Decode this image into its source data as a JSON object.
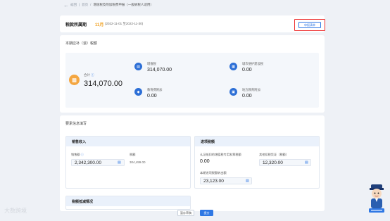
{
  "breadcrumb": {
    "back": "返回",
    "home": "首页",
    "current": "增值税及附加税费申报（一般纳税人适用）"
  },
  "period": {
    "label": "税款所属期",
    "month": "11月",
    "range": "(2022-11-01 至2022-11-30)",
    "action_button": "申报清单"
  },
  "tax_summary": {
    "title": "本期应补（退）税额",
    "total_label": "合计",
    "total_value": "314,070.00",
    "items": [
      {
        "label": "增值税",
        "value": "314,070.00",
        "icon": "vat-icon"
      },
      {
        "label": "城市维护建设税",
        "value": "0.00",
        "icon": "building-icon"
      },
      {
        "label": "教育费附加",
        "value": "0.00",
        "icon": "graduation-icon"
      },
      {
        "label": "地方教育附加",
        "value": "0.00",
        "icon": "book-icon"
      }
    ]
  },
  "basic_info": {
    "title": "要素信息填写",
    "sales": {
      "title": "销售收入",
      "amount_label": "销售额",
      "amount_value": "2,342,300.00",
      "tax_label": "税额",
      "tax_value": "304,499.00"
    },
    "input_tax": {
      "title": "进项税额",
      "cert_label": "认证抵扣的增值税专用发票税额",
      "cert_value": "0.00",
      "other_label": "其他扣税凭证（税额）",
      "other_value": "12,320.00",
      "transfer_label": "本期进项税额转出额",
      "transfer_value": "23,123.00"
    },
    "deduction": {
      "title": "税额抵减情况"
    }
  },
  "footer": {
    "save": "暂存草稿",
    "submit": "提交"
  },
  "watermark": "大数跨境",
  "colors": {
    "accent": "#2f78e4",
    "highlight": "#ee3333",
    "month": "#f0a020",
    "total_icon": "#f4a640"
  }
}
